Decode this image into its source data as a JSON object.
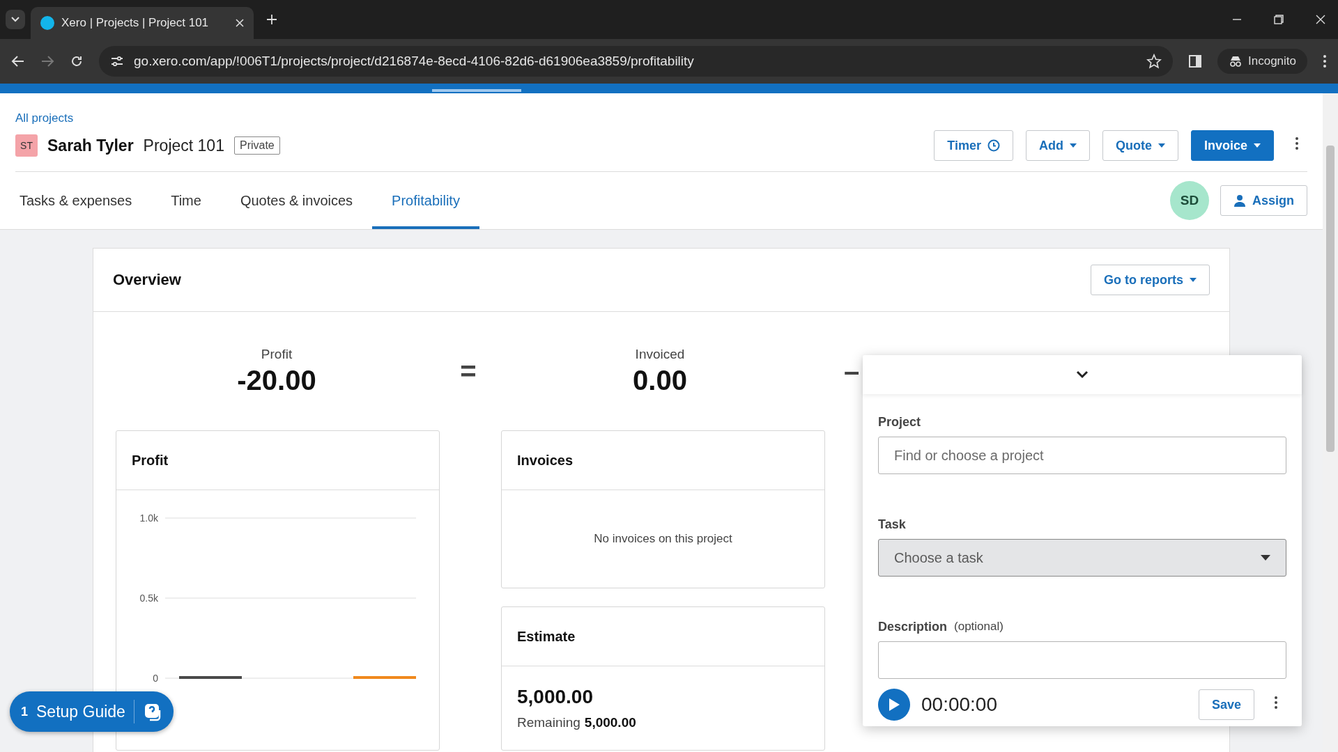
{
  "browser": {
    "tab_title": "Xero | Projects | Project 101",
    "url": "go.xero.com/app/!006T1/projects/project/d216874e-8ecd-4106-82d6-d61906ea3859/profitability",
    "profile": "Incognito"
  },
  "header": {
    "breadcrumb": "All projects",
    "avatar": "ST",
    "client": "Sarah Tyler",
    "project": "Project 101",
    "badge": "Private",
    "buttons": [
      {
        "label": "Timer",
        "kind": "timer"
      },
      {
        "label": "Add",
        "kind": "dropdown"
      },
      {
        "label": "Quote",
        "kind": "dropdown"
      },
      {
        "label": "Invoice",
        "kind": "primary"
      }
    ]
  },
  "tabs": [
    {
      "label": "Tasks & expenses",
      "selected": false
    },
    {
      "label": "Time",
      "selected": false
    },
    {
      "label": "Quotes & invoices",
      "selected": false
    },
    {
      "label": "Profitability",
      "selected": true
    }
  ],
  "assignee": "SD",
  "assign_button": "Assign",
  "overview": {
    "title": "Overview",
    "reports_button": "Go to reports",
    "summary": [
      {
        "kind": "figure",
        "label": "Profit",
        "value": "-20.00"
      },
      {
        "kind": "operator",
        "symbol": "="
      },
      {
        "kind": "figure",
        "label": "Invoiced",
        "value": "0.00"
      },
      {
        "kind": "operator",
        "symbol": "–"
      }
    ]
  },
  "profit_card": {
    "title": "Profit",
    "chart_data": {
      "type": "bar",
      "ylim": [
        0,
        1000
      ],
      "yticks": [
        {
          "value": 0,
          "label": "0"
        },
        {
          "value": 500,
          "label": "0.5k"
        },
        {
          "value": 1000,
          "label": "1.0k"
        }
      ],
      "values": [
        0,
        0
      ],
      "colors": [
        "#4a4a4a",
        "#f0891d"
      ]
    }
  },
  "invoices_card": {
    "title": "Invoices",
    "empty_text": "No invoices on this project"
  },
  "estimate_card": {
    "title": "Estimate",
    "amount": "5,000.00",
    "remaining_label": "Remaining",
    "remaining": "5,000.00"
  },
  "timer_panel": {
    "project_label": "Project",
    "project_placeholder": "Find or choose a project",
    "task_label": "Task",
    "task_placeholder": "Choose a task",
    "description_label": "Description",
    "description_hint": "(optional)",
    "time": "00:00:00",
    "save_button": "Save"
  },
  "setup_guide": {
    "count": "1",
    "label": "Setup Guide"
  }
}
